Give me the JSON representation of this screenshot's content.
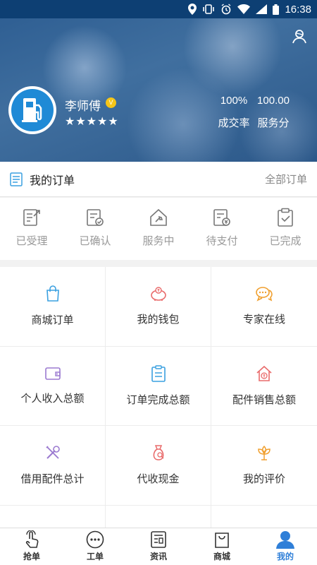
{
  "status_bar": {
    "time": "16:38"
  },
  "profile": {
    "name": "李师傅",
    "level_badge": "V",
    "stars": "★★★★★",
    "deal_rate_value": "100%",
    "deal_rate_label": "成交率",
    "service_score_value": "100.00",
    "service_score_label": "服务分"
  },
  "orders": {
    "title": "我的订单",
    "all_link": "全部订单",
    "statuses": [
      {
        "label": "已受理",
        "icon": "accepted-icon"
      },
      {
        "label": "已确认",
        "icon": "confirmed-icon"
      },
      {
        "label": "服务中",
        "icon": "in-service-icon"
      },
      {
        "label": "待支付",
        "icon": "pending-payment-icon"
      },
      {
        "label": "已完成",
        "icon": "completed-icon"
      }
    ]
  },
  "grid": {
    "items": [
      {
        "label": "商城订单",
        "icon": "shopping-bag-icon",
        "color": "#3aa0e0"
      },
      {
        "label": "我的钱包",
        "icon": "piggy-bank-icon",
        "color": "#e96b6b"
      },
      {
        "label": "专家在线",
        "icon": "chat-icon",
        "color": "#f0a030"
      },
      {
        "label": "个人收入总额",
        "icon": "wallet-icon",
        "color": "#9b7ad0"
      },
      {
        "label": "订单完成总额",
        "icon": "clipboard-icon",
        "color": "#3aa0e0"
      },
      {
        "label": "配件销售总额",
        "icon": "house-dollar-icon",
        "color": "#e96b6b"
      },
      {
        "label": "借用配件总计",
        "icon": "tools-icon",
        "color": "#9b7ad0"
      },
      {
        "label": "代收现金",
        "icon": "money-bag-icon",
        "color": "#e96b6b"
      },
      {
        "label": "我的评价",
        "icon": "flower-icon",
        "color": "#f0a030"
      }
    ]
  },
  "tabbar": {
    "tabs": [
      {
        "label": "抢单",
        "icon": "hand-tap-icon"
      },
      {
        "label": "工单",
        "icon": "more-dots-icon"
      },
      {
        "label": "资讯",
        "icon": "news-icon"
      },
      {
        "label": "商城",
        "icon": "shopping-bag-icon"
      },
      {
        "label": "我的",
        "icon": "user-icon",
        "active": true
      }
    ]
  },
  "colors": {
    "accent": "#2f7fd8",
    "header": "#2f5f93"
  }
}
